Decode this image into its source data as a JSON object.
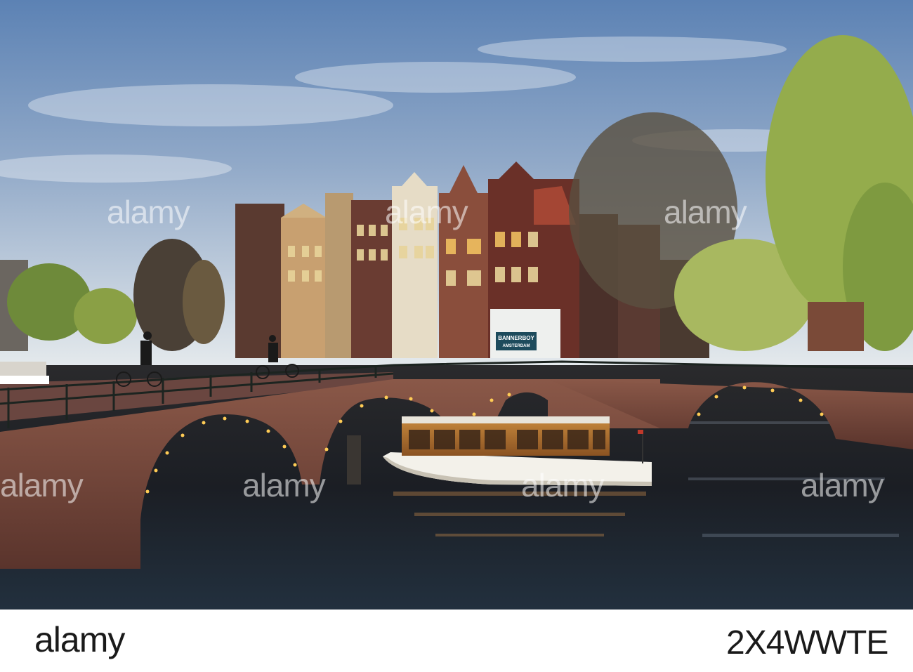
{
  "photo": {
    "subject": "canal-bridges-with-boat"
  },
  "watermark": {
    "text": "alamy"
  },
  "shop_sign": {
    "line1": "BANNERBOY",
    "line2": "AMSTERDAM"
  },
  "footer": {
    "logo": "alamy",
    "image_id": "2X4WWTE"
  },
  "colors": {
    "sky_top": "#5f84b5",
    "sky_bottom": "#dfe6ec",
    "water": "#1a1e24",
    "brick": "#7a4a3c",
    "boat_hull": "#f3f1ea",
    "boat_cabin": "#b5742e"
  }
}
